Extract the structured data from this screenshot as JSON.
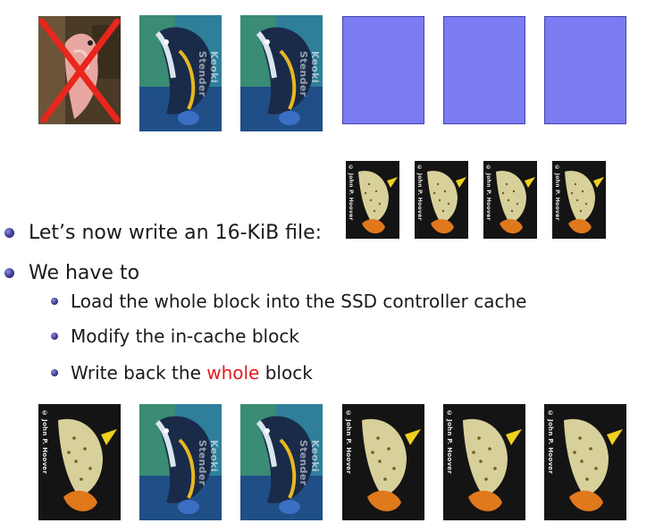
{
  "bullets": {
    "write_file": "Let’s now write an 16-KiB file:",
    "we_have_to": "We have to",
    "sub": {
      "load": "Load the whole block into the SSD controller cache",
      "modify": "Modify the in-cache block",
      "write_back_pre": "Write back the ",
      "write_back_emph": "whole",
      "write_back_post": " block"
    }
  },
  "image_credits": {
    "hoover": "© John P. Hoover",
    "shandroff": "Keoki Stender"
  },
  "colors": {
    "empty_page": "#7b7bf2",
    "emphasis": "#e31b1b",
    "bullet": "#2a2a7a"
  },
  "icons": {
    "invalid_page_mark": "red-x",
    "bullet": "ball"
  }
}
